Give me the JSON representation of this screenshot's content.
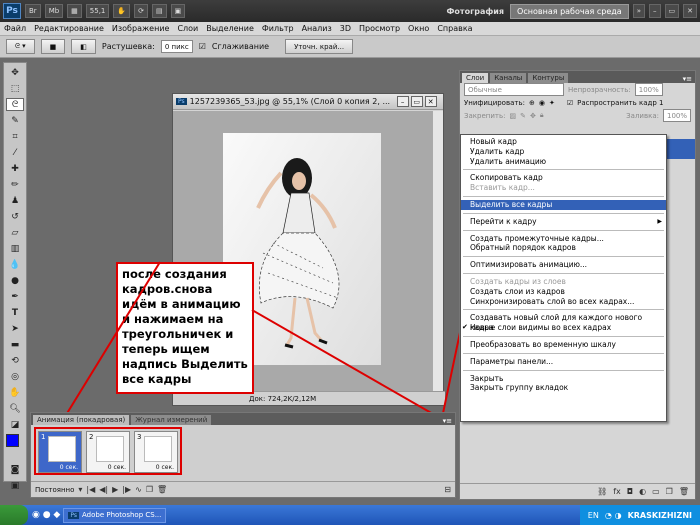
{
  "appbar": {
    "logo": "Ps",
    "br": "Br",
    "mb": "Mb",
    "zoom": "55,1",
    "workspace_label": "Фотография",
    "workspace_active": "Основная рабочая среда"
  },
  "menu": [
    "Файл",
    "Редактирование",
    "Изображение",
    "Слои",
    "Выделение",
    "Фильтр",
    "Анализ",
    "3D",
    "Просмотр",
    "Окно",
    "Справка"
  ],
  "options": {
    "feather_label": "Растушевка:",
    "feather_value": "0 пикс",
    "antialias": "Сглаживание",
    "refine_button": "Уточн. край..."
  },
  "document": {
    "title": "1257239365_53.jpg @ 55,1% (Слой 0 копия 2, ...",
    "status": "Док: 724,2K/2,12M"
  },
  "annotation": "после создания кадров.снова идём в анимацию и нажимаем на треугольничек и теперь ищем надпись Выделить все кадры",
  "animation": {
    "tab_active": "Анимация (покадровая)",
    "tab_inactive": "Журнал измерений",
    "loop": "Постоянно",
    "frames": [
      {
        "num": "1",
        "delay": "0 сек."
      },
      {
        "num": "2",
        "delay": "0 сек."
      },
      {
        "num": "3",
        "delay": "0 сек."
      }
    ]
  },
  "layers": {
    "tabs": [
      "Слои",
      "Каналы",
      "Контуры"
    ],
    "blend": "Обычные",
    "opacity_label": "Непрозрачность:",
    "opacity": "100%",
    "unify_label": "Унифицировать:",
    "propagate": "Распространить кадр 1",
    "lock_label": "Закрепить:",
    "fill_label": "Заливка:",
    "fill": "100%"
  },
  "context_menu": {
    "items": [
      {
        "label": "Новый кадр"
      },
      {
        "label": "Удалить кадр"
      },
      {
        "label": "Удалить анимацию"
      },
      {
        "sep": true
      },
      {
        "label": "Скопировать кадр"
      },
      {
        "label": "Вставить кадр...",
        "disabled": true
      },
      {
        "sep": true
      },
      {
        "label": "Выделить все кадры",
        "highlight": true
      },
      {
        "sep": true
      },
      {
        "label": "Перейти к кадру",
        "submenu": true
      },
      {
        "sep": true
      },
      {
        "label": "Создать промежуточные кадры..."
      },
      {
        "label": "Обратный порядок кадров"
      },
      {
        "sep": true
      },
      {
        "label": "Оптимизировать анимацию..."
      },
      {
        "sep": true
      },
      {
        "label": "Создать кадры из слоев",
        "disabled": true
      },
      {
        "label": "Создать слои из кадров"
      },
      {
        "label": "Синхронизировать слой во всех кадрах..."
      },
      {
        "sep": true
      },
      {
        "label": "Создавать новый слой для каждого нового кадра"
      },
      {
        "label": "Новые слои видимы во всех кадрах",
        "checked": true
      },
      {
        "sep": true
      },
      {
        "label": "Преобразовать во временную шкалу"
      },
      {
        "sep": true
      },
      {
        "label": "Параметры панели..."
      },
      {
        "sep": true
      },
      {
        "label": "Закрыть"
      },
      {
        "label": "Закрыть группу вкладок"
      }
    ]
  },
  "taskbar": {
    "task": "Adobe Photoshop CS...",
    "lang": "EN",
    "brand": "KRASKIZHIZNI"
  },
  "colors": {
    "highlight": "#3361b7",
    "annotation_border": "#d00000",
    "foreground": "#0000ff"
  }
}
